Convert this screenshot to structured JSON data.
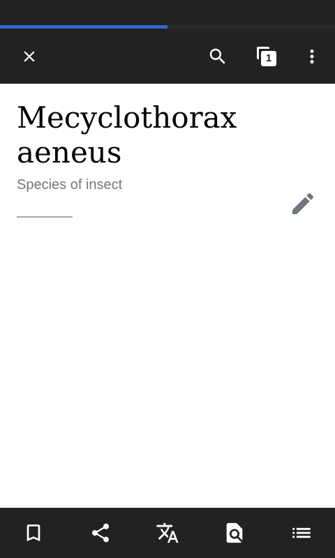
{
  "progress": {
    "percent": 50
  },
  "toolbar": {
    "icons": [
      "close-icon",
      "search-icon",
      "tabs-icon",
      "more-vert-icon"
    ],
    "tab_count": "1"
  },
  "article": {
    "title": "Mecyclothorax aeneus",
    "description": "Species of insect"
  },
  "bottom_bar": {
    "icons": [
      "bookmark-icon",
      "share-icon",
      "translate-icon",
      "find-in-page-icon",
      "contents-icon"
    ]
  },
  "colors": {
    "bar_background": "#222222",
    "progress": "#3366cc",
    "subtitle": "#72777d",
    "edit_icon": "#72777d"
  }
}
